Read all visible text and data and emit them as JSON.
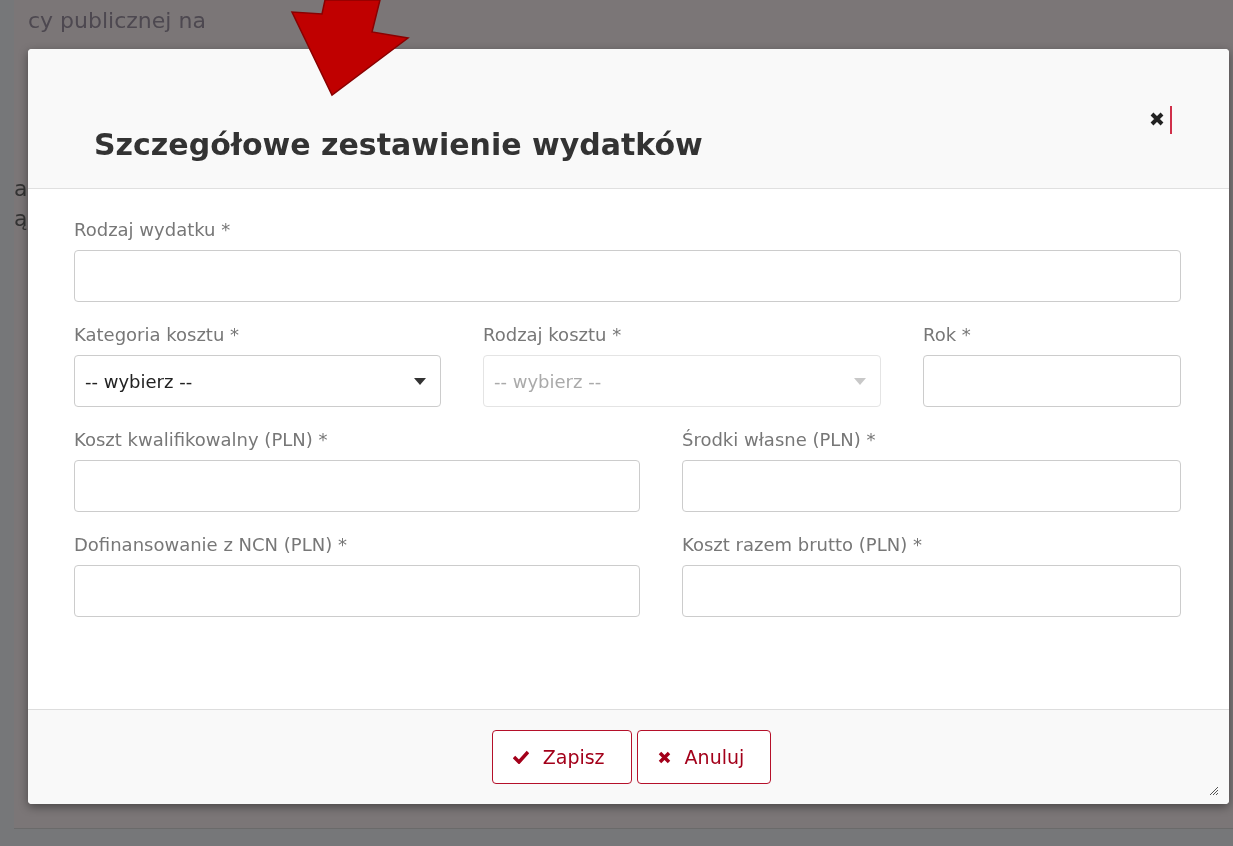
{
  "background": {
    "lines": [
      "cy publicznej na"
    ],
    "fragments": [
      "a",
      "ą"
    ]
  },
  "dialog": {
    "title": "Szczegółowe zestawienie wydatków",
    "rows": [
      [
        {
          "kind": "text",
          "label": "Rodzaj wydatku *",
          "disabled": false
        }
      ],
      [
        {
          "kind": "select",
          "label": "Kategoria kosztu *",
          "value": "-- wybierz --",
          "disabled": false
        },
        {
          "kind": "select",
          "label": "Rodzaj kosztu *",
          "value": "-- wybierz --",
          "disabled": true
        },
        {
          "kind": "text",
          "label": "Rok *",
          "disabled": false
        }
      ],
      [
        {
          "kind": "text",
          "label": "Koszt kwalifikowalny (PLN) *",
          "disabled": false
        },
        {
          "kind": "text",
          "label": "Środki własne (PLN) *",
          "disabled": false
        }
      ],
      [
        {
          "kind": "text",
          "label": "Dofinansowanie z NCN (PLN) *",
          "disabled": false
        },
        {
          "kind": "text",
          "label": "Koszt razem brutto (PLN) *",
          "disabled": false
        }
      ]
    ],
    "buttons": [
      {
        "kind": "save",
        "label": "Zapisz"
      },
      {
        "kind": "cancel",
        "label": "Anuluj"
      }
    ]
  }
}
